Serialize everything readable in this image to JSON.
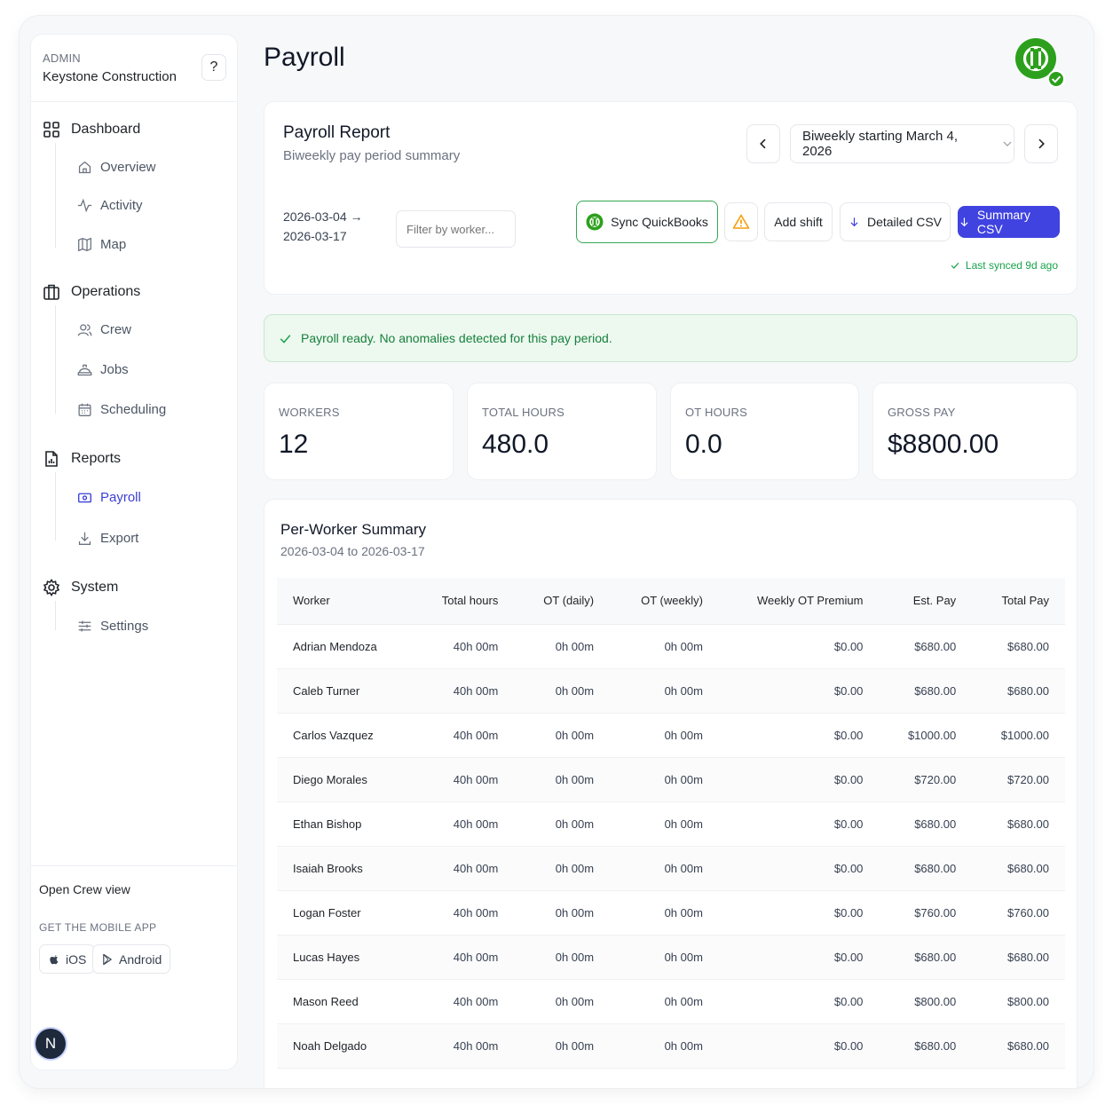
{
  "sidebar": {
    "role": "ADMIN",
    "org": "Keystone Construction",
    "help": "?",
    "sections": [
      {
        "label": "Dashboard",
        "icon": "grid-icon",
        "items": [
          {
            "label": "Overview",
            "icon": "home-icon"
          },
          {
            "label": "Activity",
            "icon": "activity-icon"
          },
          {
            "label": "Map",
            "icon": "map-icon"
          }
        ]
      },
      {
        "label": "Operations",
        "icon": "briefcase-icon",
        "items": [
          {
            "label": "Crew",
            "icon": "users-icon"
          },
          {
            "label": "Jobs",
            "icon": "hardhat-icon"
          },
          {
            "label": "Scheduling",
            "icon": "calendar-icon"
          }
        ]
      },
      {
        "label": "Reports",
        "icon": "report-icon",
        "items": [
          {
            "label": "Payroll",
            "icon": "money-icon"
          },
          {
            "label": "Export",
            "icon": "download-icon"
          }
        ]
      },
      {
        "label": "System",
        "icon": "gear-icon",
        "items": [
          {
            "label": "Settings",
            "icon": "sliders-icon"
          }
        ]
      }
    ],
    "active_item": "Payroll",
    "open_crew": "Open Crew view",
    "get_app": "GET THE MOBILE APP",
    "ios": "iOS",
    "android": "Android",
    "avatar": "N"
  },
  "header": {
    "title": "Payroll"
  },
  "report": {
    "title": "Payroll Report",
    "subtitle": "Biweekly pay period summary",
    "period": "Biweekly starting March 4, 2026",
    "range_start": "2026-03-04 →",
    "range_end": "2026-03-17",
    "filter_placeholder": "Filter by worker...",
    "sync_label": "Sync QuickBooks",
    "add_shift": "Add shift",
    "detailed_csv": "Detailed CSV",
    "summary_csv": "Summary CSV",
    "last_synced": "Last synced 9d ago"
  },
  "banner": {
    "text": "Payroll ready. No anomalies detected for this pay period."
  },
  "stats": [
    {
      "label": "WORKERS",
      "value": "12"
    },
    {
      "label": "TOTAL HOURS",
      "value": "480.0"
    },
    {
      "label": "OT HOURS",
      "value": "0.0"
    },
    {
      "label": "GROSS PAY",
      "value": "$8800.00"
    }
  ],
  "summary": {
    "title": "Per-Worker Summary",
    "subtitle": "2026-03-04 to 2026-03-17",
    "columns": [
      "Worker",
      "Total hours",
      "OT (daily)",
      "OT (weekly)",
      "Weekly OT Premium",
      "Est. Pay",
      "Total Pay"
    ],
    "rows": [
      [
        "Adrian Mendoza",
        "40h 00m",
        "0h 00m",
        "0h 00m",
        "$0.00",
        "$680.00",
        "$680.00"
      ],
      [
        "Caleb Turner",
        "40h 00m",
        "0h 00m",
        "0h 00m",
        "$0.00",
        "$680.00",
        "$680.00"
      ],
      [
        "Carlos Vazquez",
        "40h 00m",
        "0h 00m",
        "0h 00m",
        "$0.00",
        "$1000.00",
        "$1000.00"
      ],
      [
        "Diego Morales",
        "40h 00m",
        "0h 00m",
        "0h 00m",
        "$0.00",
        "$720.00",
        "$720.00"
      ],
      [
        "Ethan Bishop",
        "40h 00m",
        "0h 00m",
        "0h 00m",
        "$0.00",
        "$680.00",
        "$680.00"
      ],
      [
        "Isaiah Brooks",
        "40h 00m",
        "0h 00m",
        "0h 00m",
        "$0.00",
        "$680.00",
        "$680.00"
      ],
      [
        "Logan Foster",
        "40h 00m",
        "0h 00m",
        "0h 00m",
        "$0.00",
        "$760.00",
        "$760.00"
      ],
      [
        "Lucas Hayes",
        "40h 00m",
        "0h 00m",
        "0h 00m",
        "$0.00",
        "$680.00",
        "$680.00"
      ],
      [
        "Mason Reed",
        "40h 00m",
        "0h 00m",
        "0h 00m",
        "$0.00",
        "$800.00",
        "$800.00"
      ],
      [
        "Noah Delgado",
        "40h 00m",
        "0h 00m",
        "0h 00m",
        "$0.00",
        "$680.00",
        "$680.00"
      ]
    ]
  },
  "colors": {
    "accent": "#4043e0",
    "quickbooks": "#2ca01c",
    "success": "#16a34a",
    "warning": "#f59e0b"
  }
}
